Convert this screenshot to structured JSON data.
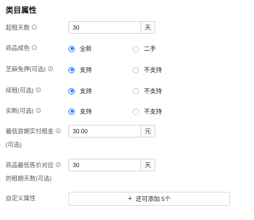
{
  "section_title": "类目属性",
  "fields": {
    "min_rent_days": {
      "label": "起租天数",
      "value": "30",
      "unit": "天"
    },
    "condition": {
      "label": "商品成色",
      "options": [
        "全新",
        "二手"
      ],
      "selected": "全新"
    },
    "sesame_deposit_free": {
      "label": "芝麻免押(可选)",
      "options": [
        "支持",
        "不支持"
      ],
      "selected": "支持"
    },
    "renewal": {
      "label": "续租(可选)",
      "options": [
        "支持",
        "不支持"
      ],
      "selected": "支持"
    },
    "buyout": {
      "label": "买断(可选)",
      "options": [
        "支持",
        "不支持"
      ],
      "selected": "支持"
    },
    "min_first_rent": {
      "label_line1": "最低首期实付租金",
      "label_line2": "(可选)",
      "value": "30.00",
      "unit": "元"
    },
    "min_sale_rent_days": {
      "label_line1": "商品最低售价对应",
      "label_line2": "的租期天数(可选)",
      "value": "30",
      "unit": "天"
    },
    "custom_attributes": {
      "label": "自定义属性",
      "button_label": "还可添加 5个"
    }
  },
  "icons": {
    "question": "question-circle-icon",
    "info": "info-circle-icon",
    "plus": "plus-icon"
  },
  "colors": {
    "accent": "#1677ff",
    "border": "#d6d6d6"
  }
}
